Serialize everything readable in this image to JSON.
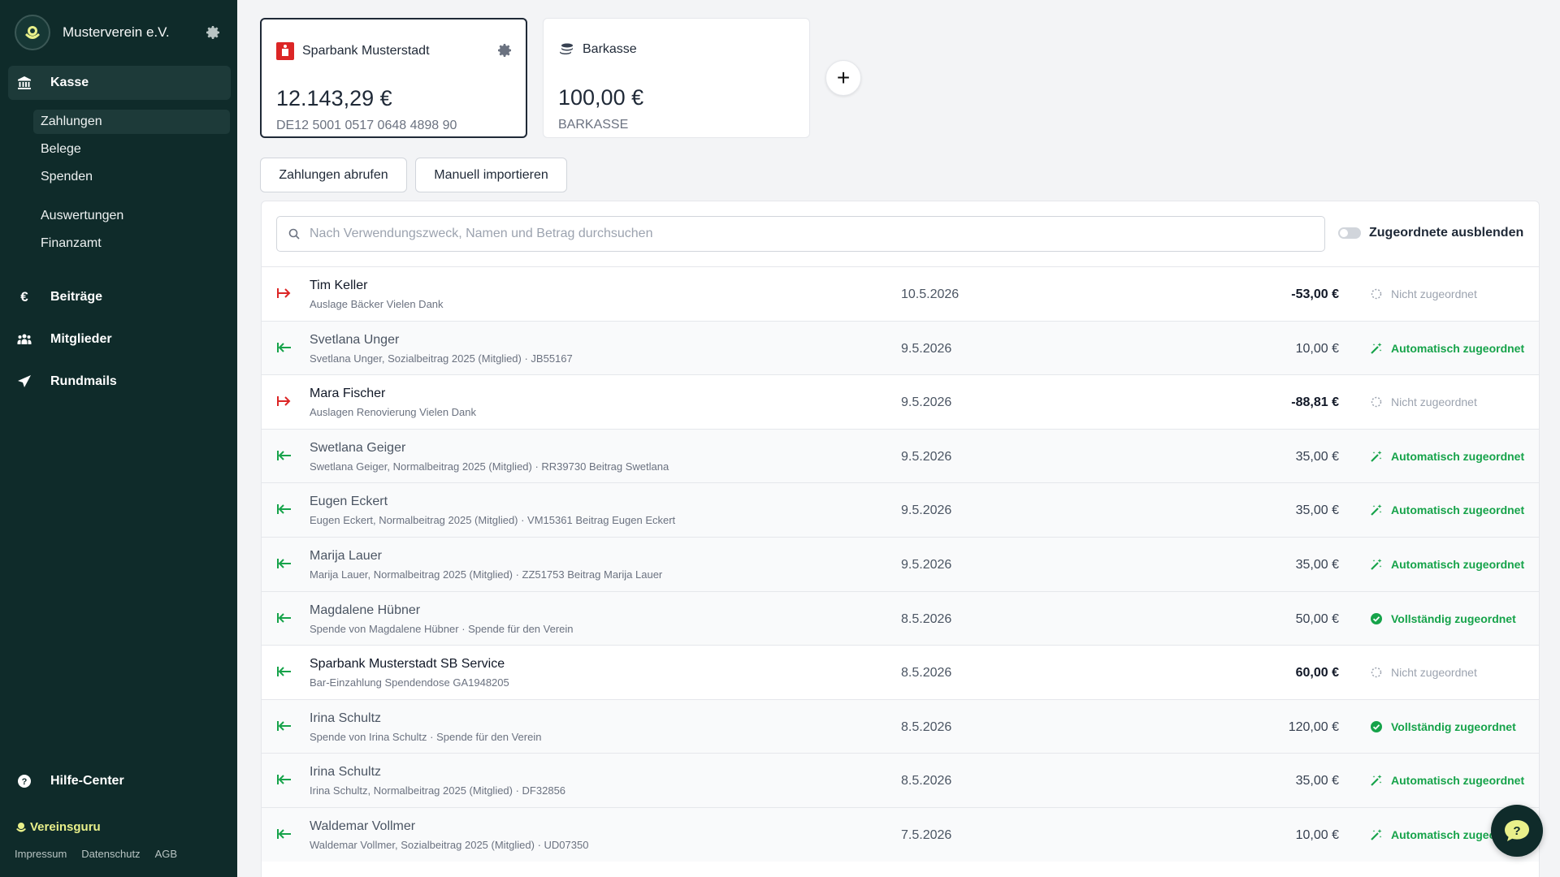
{
  "sidebar": {
    "org_name": "Musterverein e.V.",
    "nav": [
      {
        "label": "Kasse"
      },
      {
        "label": "Beiträge"
      },
      {
        "label": "Mitglieder"
      },
      {
        "label": "Rundmails"
      },
      {
        "label": "Hilfe-Center"
      }
    ],
    "sub": [
      {
        "label": "Zahlungen"
      },
      {
        "label": "Belege"
      },
      {
        "label": "Spenden"
      },
      {
        "label": "Auswertungen"
      },
      {
        "label": "Finanzamt"
      }
    ],
    "brand": "Vereinsguru",
    "footer": [
      "Impressum",
      "Datenschutz",
      "AGB"
    ]
  },
  "accounts": [
    {
      "name": "Sparbank Musterstadt",
      "amount": "12.143,29 €",
      "sub": "DE12 5001 0517 0648 4898 90"
    },
    {
      "name": "Barkasse",
      "amount": "100,00 €",
      "sub": "BARKASSE"
    }
  ],
  "buttons": {
    "fetch": "Zahlungen abrufen",
    "import": "Manuell importieren"
  },
  "search": {
    "placeholder": "Nach Verwendungszweck, Namen und Betrag durchsuchen"
  },
  "toggle_label": "Zugeordnete ausblenden",
  "colors": {
    "sidebar": "#0f2b2a",
    "green": "#16a34a",
    "red": "#dc2626"
  },
  "payments": [
    {
      "name": "Tim Keller",
      "desc": "Auslage Bäcker Vielen Dank",
      "date": "10.5.2026",
      "amount": "-53,00 €",
      "status": "Nicht zugeordnet",
      "dir": "out",
      "kind": "none"
    },
    {
      "name": "Svetlana Unger",
      "desc": "Svetlana Unger, Sozialbeitrag 2025 (Mitglied) · JB55167",
      "date": "9.5.2026",
      "amount": "10,00 €",
      "status": "Automatisch zugeordnet",
      "dir": "in",
      "kind": "auto"
    },
    {
      "name": "Mara Fischer",
      "desc": "Auslagen Renovierung Vielen Dank",
      "date": "9.5.2026",
      "amount": "-88,81 €",
      "status": "Nicht zugeordnet",
      "dir": "out",
      "kind": "none"
    },
    {
      "name": "Swetlana Geiger",
      "desc": "Swetlana Geiger, Normalbeitrag 2025 (Mitglied) · RR39730 Beitrag Swetlana",
      "date": "9.5.2026",
      "amount": "35,00 €",
      "status": "Automatisch zugeordnet",
      "dir": "in",
      "kind": "auto"
    },
    {
      "name": "Eugen Eckert",
      "desc": "Eugen Eckert, Normalbeitrag 2025 (Mitglied) · VM15361 Beitrag Eugen Eckert",
      "date": "9.5.2026",
      "amount": "35,00 €",
      "status": "Automatisch zugeordnet",
      "dir": "in",
      "kind": "auto"
    },
    {
      "name": "Marija Lauer",
      "desc": "Marija Lauer, Normalbeitrag 2025 (Mitglied) · ZZ51753 Beitrag Marija Lauer",
      "date": "9.5.2026",
      "amount": "35,00 €",
      "status": "Automatisch zugeordnet",
      "dir": "in",
      "kind": "auto"
    },
    {
      "name": "Magdalene Hübner",
      "desc": "Spende von Magdalene Hübner · Spende für den Verein",
      "date": "8.5.2026",
      "amount": "50,00 €",
      "status": "Vollständig zugeordnet",
      "dir": "in",
      "kind": "full"
    },
    {
      "name": "Sparbank Musterstadt SB Service",
      "desc": "Bar-Einzahlung Spendendose GA1948205",
      "date": "8.5.2026",
      "amount": "60,00 €",
      "status": "Nicht zugeordnet",
      "dir": "in",
      "kind": "none"
    },
    {
      "name": "Irina Schultz",
      "desc": "Spende von Irina Schultz · Spende für den Verein",
      "date": "8.5.2026",
      "amount": "120,00 €",
      "status": "Vollständig zugeordnet",
      "dir": "in",
      "kind": "full"
    },
    {
      "name": "Irina Schultz",
      "desc": "Irina Schultz, Normalbeitrag 2025 (Mitglied) · DF32856",
      "date": "8.5.2026",
      "amount": "35,00 €",
      "status": "Automatisch zugeordnet",
      "dir": "in",
      "kind": "auto"
    },
    {
      "name": "Waldemar Vollmer",
      "desc": "Waldemar Vollmer, Sozialbeitrag 2025 (Mitglied) · UD07350",
      "date": "7.5.2026",
      "amount": "10,00 €",
      "status": "Automatisch zugeordnet",
      "dir": "in",
      "kind": "auto"
    }
  ]
}
